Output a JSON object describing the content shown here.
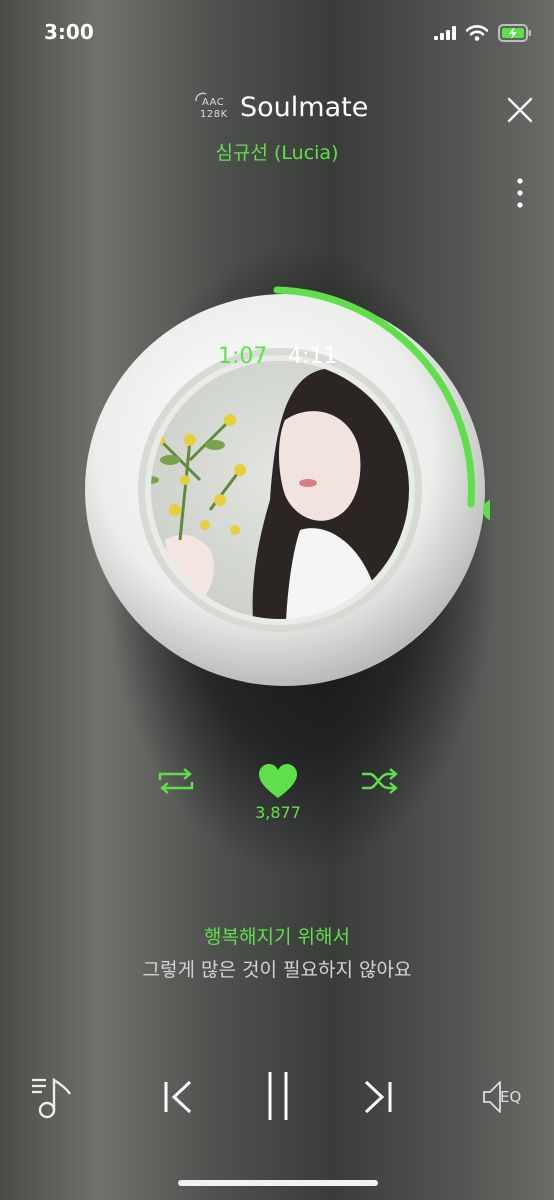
{
  "status_bar": {
    "time": "3:00"
  },
  "header": {
    "codec_line1": "AAC",
    "codec_line2": "128K",
    "title": "Soulmate",
    "artist": "심규선 (Lucia)"
  },
  "player": {
    "current_time": "1:07",
    "separator": "·",
    "total_time": "4:11",
    "progress_fraction": 0.27,
    "likes": "3,877"
  },
  "lyrics": {
    "current": "행복해지기 위해서",
    "next": "그렇게 많은 것이 필요하지 않아요"
  },
  "controls": {
    "eq_label": "EQ"
  },
  "colors": {
    "accent": "#5fe04a",
    "text": "#ffffff",
    "muted": "#d4d4d4"
  },
  "icons": [
    "signal-icon",
    "wifi-icon",
    "battery-charging-icon",
    "codec-icon",
    "close-icon",
    "more-vertical-icon",
    "repeat-icon",
    "heart-icon",
    "shuffle-icon",
    "playlist-icon",
    "previous-icon",
    "pause-icon",
    "next-icon",
    "eq-icon"
  ]
}
